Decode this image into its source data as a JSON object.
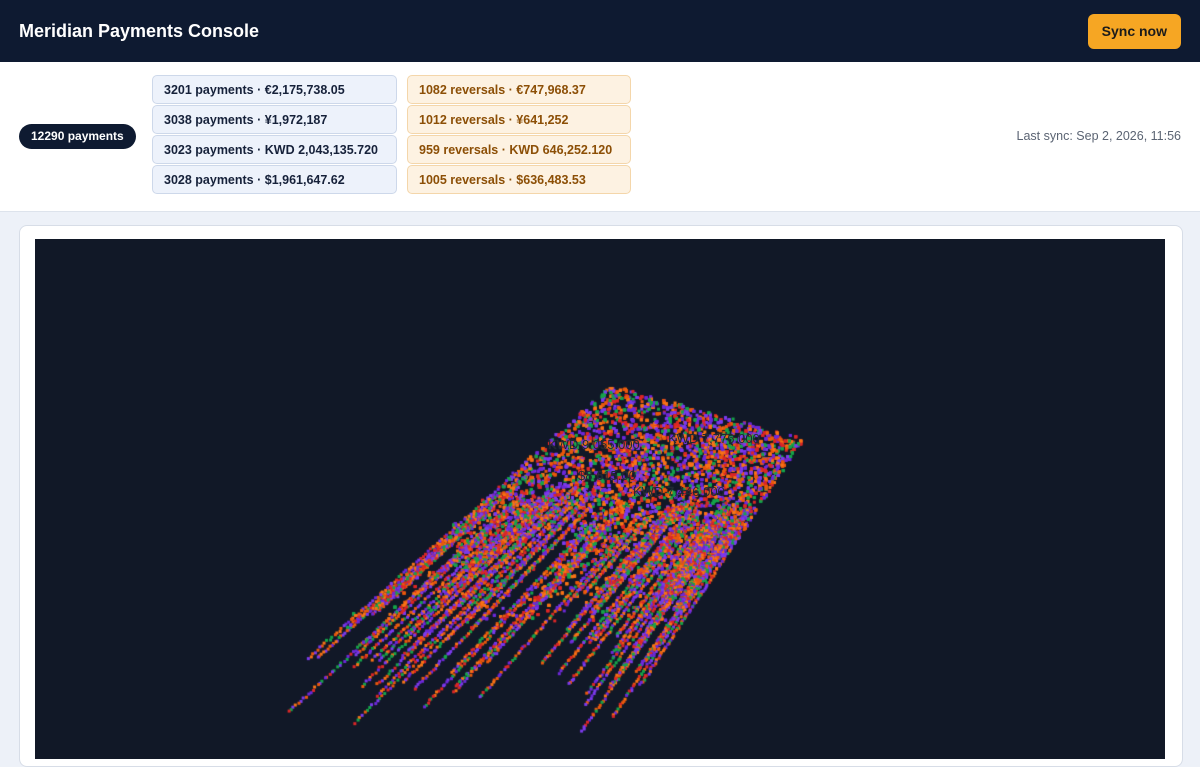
{
  "header": {
    "title": "Meridian Payments Console",
    "sync_button": "Sync now"
  },
  "summary": {
    "total": "12290 payments",
    "last_sync": "Last sync: Sep 2, 2026, 11:56",
    "payments": [
      "3201 payments · €2,175,738.05",
      "3038 payments · ¥1,972,187",
      "3023 payments · KWD 2,043,135.720",
      "3028 payments · $1,961,647.62"
    ],
    "reversals": [
      "1082 reversals · €747,968.37",
      "1012 reversals · ¥641,252",
      "959 reversals · KWD 646,252.120",
      "1005 reversals · $636,483.53"
    ]
  },
  "visualization": {
    "labels": [
      "KWD 9,055.000",
      "KWD 7,776.000",
      "$8,615.00",
      "KWD 7,446.000"
    ],
    "colors": {
      "background": "#111827",
      "marks": [
        "#7c3aed",
        "#f97316",
        "#6d28d9",
        "#ea580c",
        "#16a34a",
        "#dc2626"
      ]
    }
  }
}
